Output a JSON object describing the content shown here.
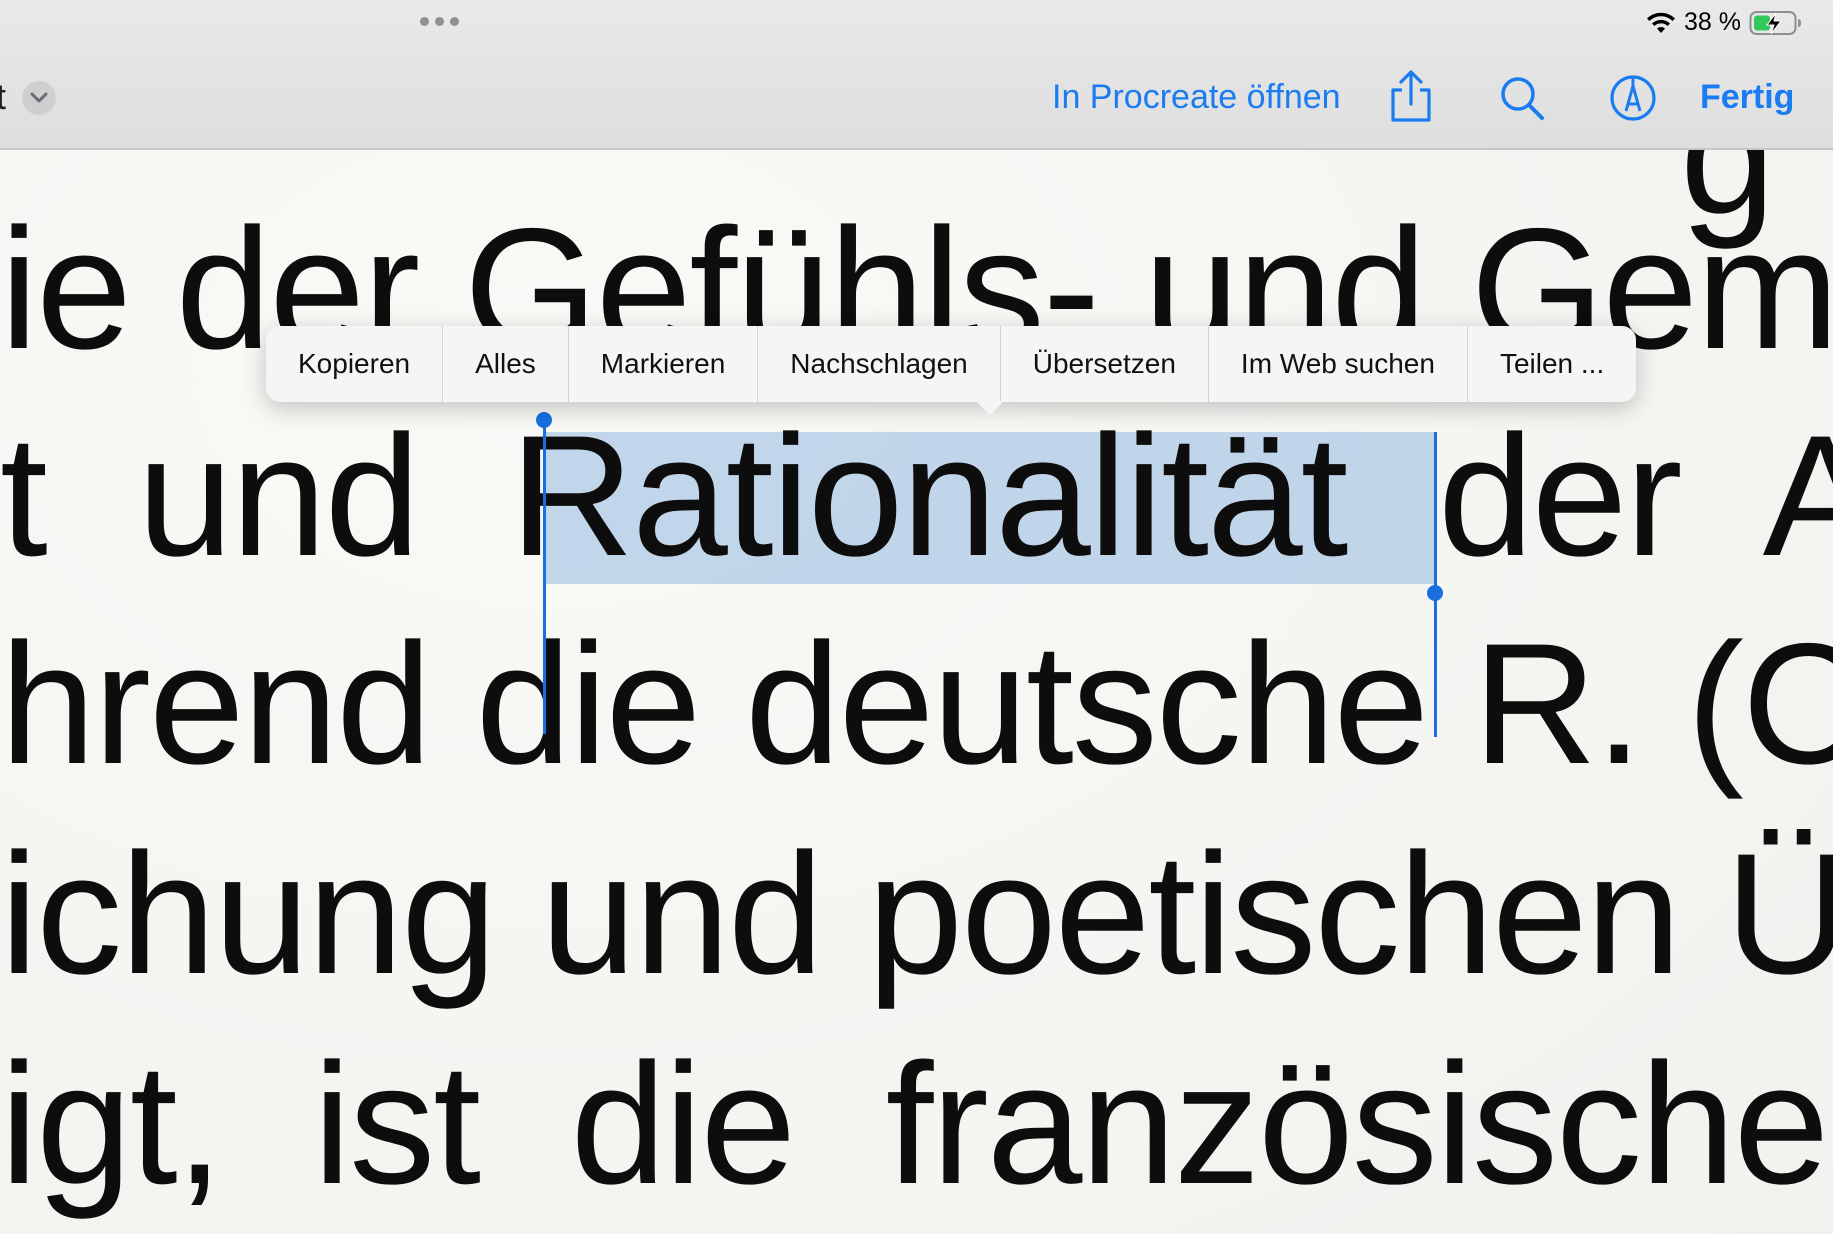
{
  "status_bar": {
    "battery_text": "38 %"
  },
  "toolbar": {
    "back_fragment": "t",
    "open_in_label": "In Procreate öffnen",
    "done_label": "Fertig",
    "icons": [
      "chevron-down-icon",
      "share-icon",
      "search-icon",
      "markup-icon"
    ]
  },
  "document": {
    "lines": [
      "ie der Gefühls- und Gemü",
      "t  und  ",
      "hrend die deutsche R. (C",
      "ichung und poetischen Üb",
      "igt,  ist  die  französische"
    ],
    "selected_word": "Rationalität",
    "after_selection": "  der  A",
    "top_fragment": "g"
  },
  "context_menu": {
    "items": [
      "Kopieren",
      "Alles",
      "Markieren",
      "Nachschlagen",
      "Übersetzen",
      "Im Web suchen",
      "Teilen ..."
    ]
  },
  "colors": {
    "accent": "#1a7cf0",
    "selection": "#b4cbe6",
    "toolbar_bg": "#e4e4e4"
  }
}
